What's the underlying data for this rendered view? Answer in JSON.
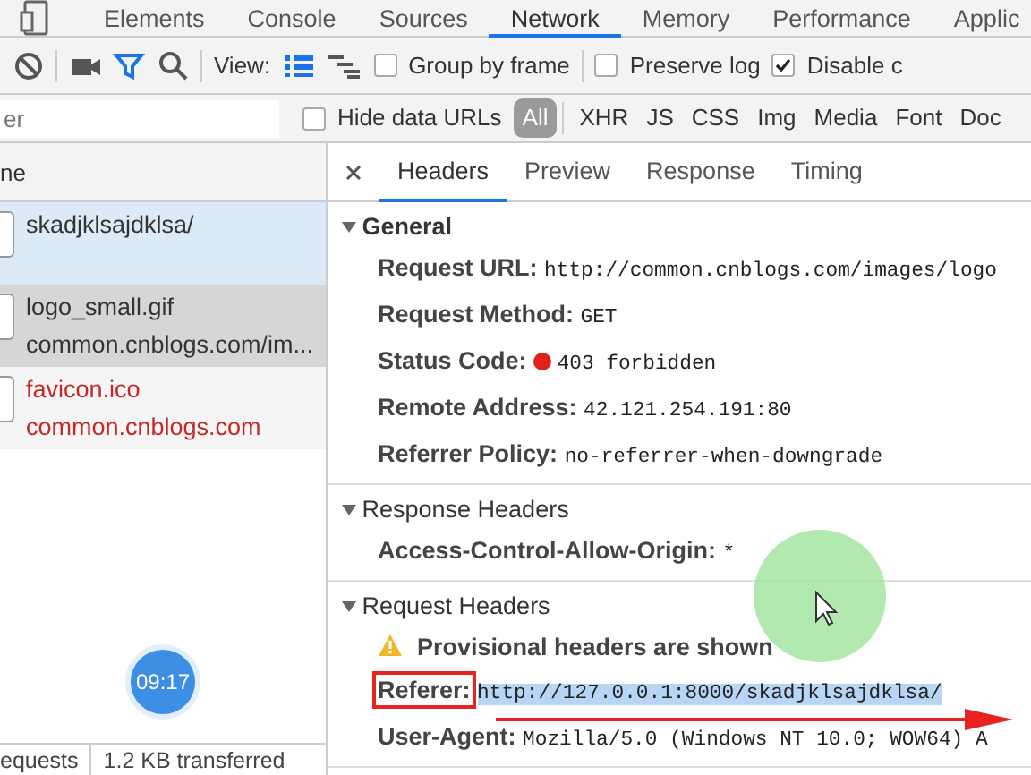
{
  "panel_tabs": [
    {
      "label": "Elements",
      "selected": false
    },
    {
      "label": "Console",
      "selected": false
    },
    {
      "label": "Sources",
      "selected": false
    },
    {
      "label": "Network",
      "selected": true
    },
    {
      "label": "Memory",
      "selected": false
    },
    {
      "label": "Performance",
      "selected": false
    },
    {
      "label": "Applic",
      "selected": false
    }
  ],
  "toolbar": {
    "filter_active": true,
    "view_label": "View:",
    "large_rows_selected": true,
    "checkboxes": [
      {
        "label": "Group by frame",
        "checked": false
      },
      {
        "label": "Preserve log",
        "checked": false
      },
      {
        "label": "Disable c",
        "checked": true
      }
    ]
  },
  "filter_bar": {
    "placeholder": "er",
    "hide_data_urls": {
      "label": "Hide data URLs",
      "checked": false
    },
    "types": [
      {
        "label": "All",
        "selected": true
      },
      {
        "label": "XHR",
        "selected": false
      },
      {
        "label": "JS",
        "selected": false
      },
      {
        "label": "CSS",
        "selected": false
      },
      {
        "label": "Img",
        "selected": false
      },
      {
        "label": "Media",
        "selected": false
      },
      {
        "label": "Font",
        "selected": false
      },
      {
        "label": "Doc",
        "selected": false
      }
    ]
  },
  "requests_header": "ne",
  "requests": [
    {
      "name": "skadjklsajdklsa/",
      "selected": true,
      "hovered": false,
      "failed": false
    },
    {
      "name": "logo_small.gif",
      "domain": "common.cnblogs.com/im...",
      "selected": false,
      "hovered": true,
      "failed": false
    },
    {
      "name": "favicon.ico",
      "domain": "common.cnblogs.com",
      "selected": false,
      "hovered": false,
      "failed": true
    }
  ],
  "clock_badge": "09:17",
  "status_bar": [
    "equests",
    "1.2 KB transferred"
  ],
  "detail_tabs": [
    {
      "label": "Headers",
      "selected": true
    },
    {
      "label": "Preview",
      "selected": false
    },
    {
      "label": "Response",
      "selected": false
    },
    {
      "label": "Timing",
      "selected": false
    }
  ],
  "sections": [
    {
      "title": "General",
      "expanded": true,
      "bold_title": true,
      "rows": [
        {
          "kind": "pair",
          "label": "Request URL:",
          "value": "http://common.cnblogs.com/images/logo"
        },
        {
          "kind": "pair",
          "label": "Request Method:",
          "value": "GET"
        },
        {
          "kind": "status",
          "label": "Status Code:",
          "value": "403 forbidden",
          "color": "#e0201a"
        },
        {
          "kind": "pair",
          "label": "Remote Address:",
          "value": "42.121.254.191:80"
        },
        {
          "kind": "pair",
          "label": "Referrer Policy:",
          "value": "no-referrer-when-downgrade"
        }
      ]
    },
    {
      "title": "Response Headers",
      "expanded": true,
      "bold_title": false,
      "rows": [
        {
          "kind": "pair",
          "label": "Access-Control-Allow-Origin:",
          "value": "*"
        }
      ]
    },
    {
      "title": "Request Headers",
      "expanded": true,
      "bold_title": false,
      "rows": [
        {
          "kind": "warning",
          "label": "Provisional headers are shown"
        },
        {
          "kind": "pair",
          "label": "Referer:",
          "value": "http://127.0.0.1:8000/skadjklsajdklsa/",
          "highlighted": true,
          "annotated": true
        },
        {
          "kind": "pair",
          "label": "User-Agent:",
          "value": "Mozilla/5.0 (Windows NT 10.0; WOW64) A"
        }
      ]
    }
  ]
}
